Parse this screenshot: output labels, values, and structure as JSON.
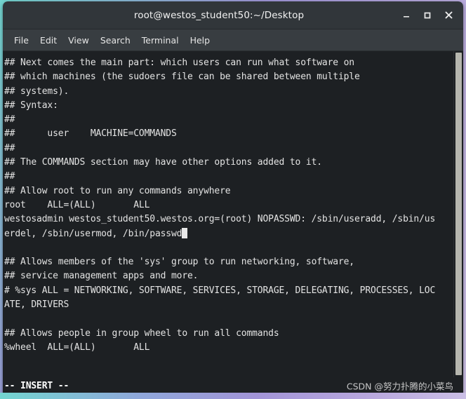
{
  "window": {
    "title": "root@westos_student50:~/Desktop",
    "controls": [
      {
        "name": "minimize",
        "label": "_"
      },
      {
        "name": "maximize",
        "label": "□"
      },
      {
        "name": "close",
        "label": "✕"
      }
    ]
  },
  "menubar": {
    "items": [
      {
        "id": "file",
        "label": "File"
      },
      {
        "id": "edit",
        "label": "Edit"
      },
      {
        "id": "view",
        "label": "View"
      },
      {
        "id": "search",
        "label": "Search"
      },
      {
        "id": "terminal",
        "label": "Terminal"
      },
      {
        "id": "help",
        "label": "Help"
      }
    ]
  },
  "terminal": {
    "lines": [
      "## Next comes the main part: which users can run what software on",
      "## which machines (the sudoers file can be shared between multiple",
      "## systems).",
      "## Syntax:",
      "##",
      "##      user    MACHINE=COMMANDS",
      "##",
      "## The COMMANDS section may have other options added to it.",
      "##",
      "## Allow root to run any commands anywhere",
      "root    ALL=(ALL)       ALL",
      "westosadmin westos_student50.westos.org=(root) NOPASSWD: /sbin/useradd, /sbin/us",
      "erdel, /sbin/usermod, /bin/passwd",
      "",
      "## Allows members of the 'sys' group to run networking, software,",
      "## service management apps and more.",
      "# %sys ALL = NETWORKING, SOFTWARE, SERVICES, STORAGE, DELEGATING, PROCESSES, LOC",
      "ATE, DRIVERS",
      "",
      "## Allows people in group wheel to run all commands",
      "%wheel  ALL=(ALL)       ALL"
    ],
    "cursor_line_index": 12,
    "cursor_visible": true,
    "foreground_color": "#e3e3e3",
    "background_color": "#1d2023"
  },
  "statusbar": {
    "mode": "-- INSERT --",
    "watermark": "CSDN @努力扑腾的小菜鸟"
  }
}
